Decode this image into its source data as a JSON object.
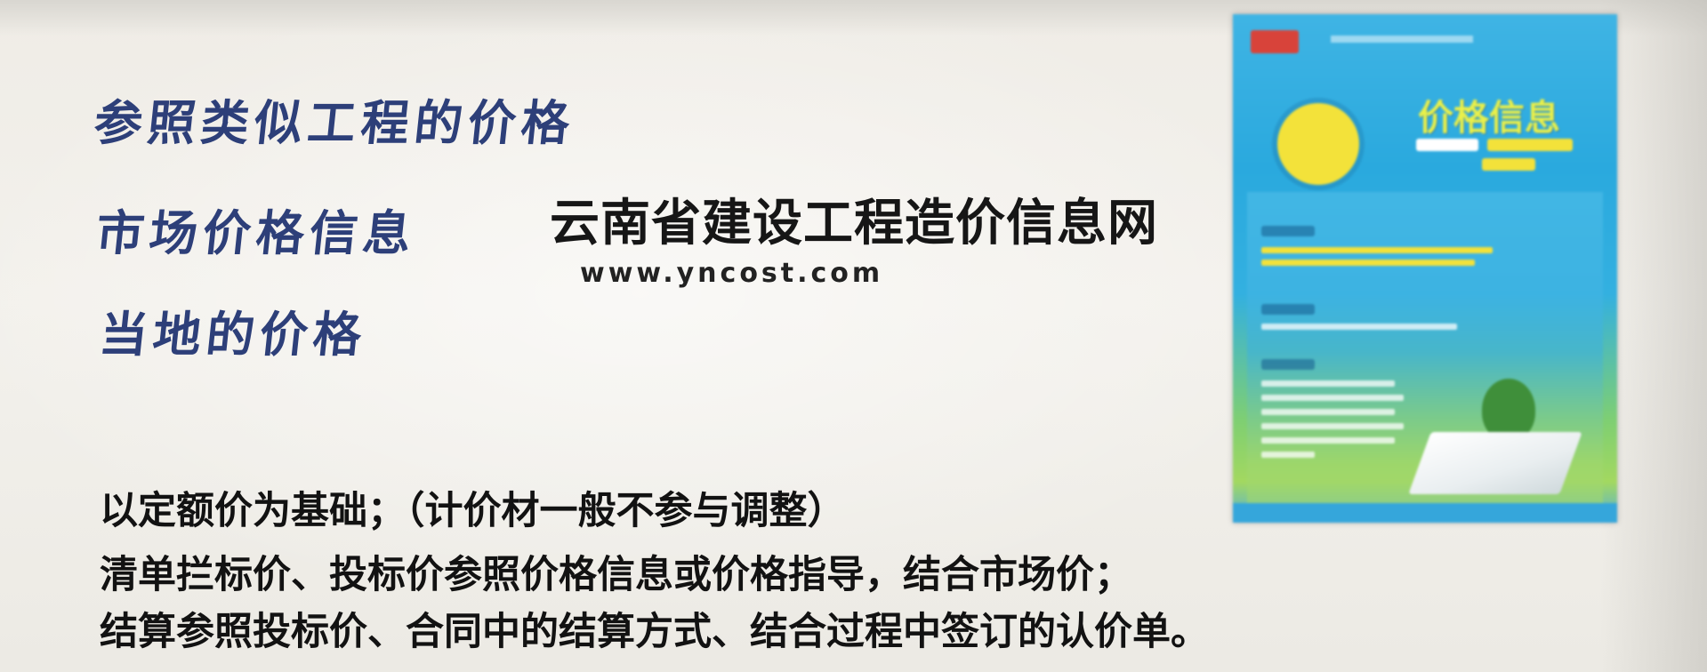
{
  "headings": [
    "参照类似工程的价格",
    "市场价格信息",
    "当地的价格"
  ],
  "website": {
    "title": "云南省建设工程造价信息网",
    "url": "www.yncost.com"
  },
  "body_lines": [
    "以定额价为基础；（计价材一般不参与调整）",
    "清单拦标价、投标价参照价格信息或价格指导，结合市场价；",
    "结算参照投标价、合同中的结算方式、结合过程中签订的认价单。"
  ],
  "cover": {
    "title": "价格信息"
  }
}
